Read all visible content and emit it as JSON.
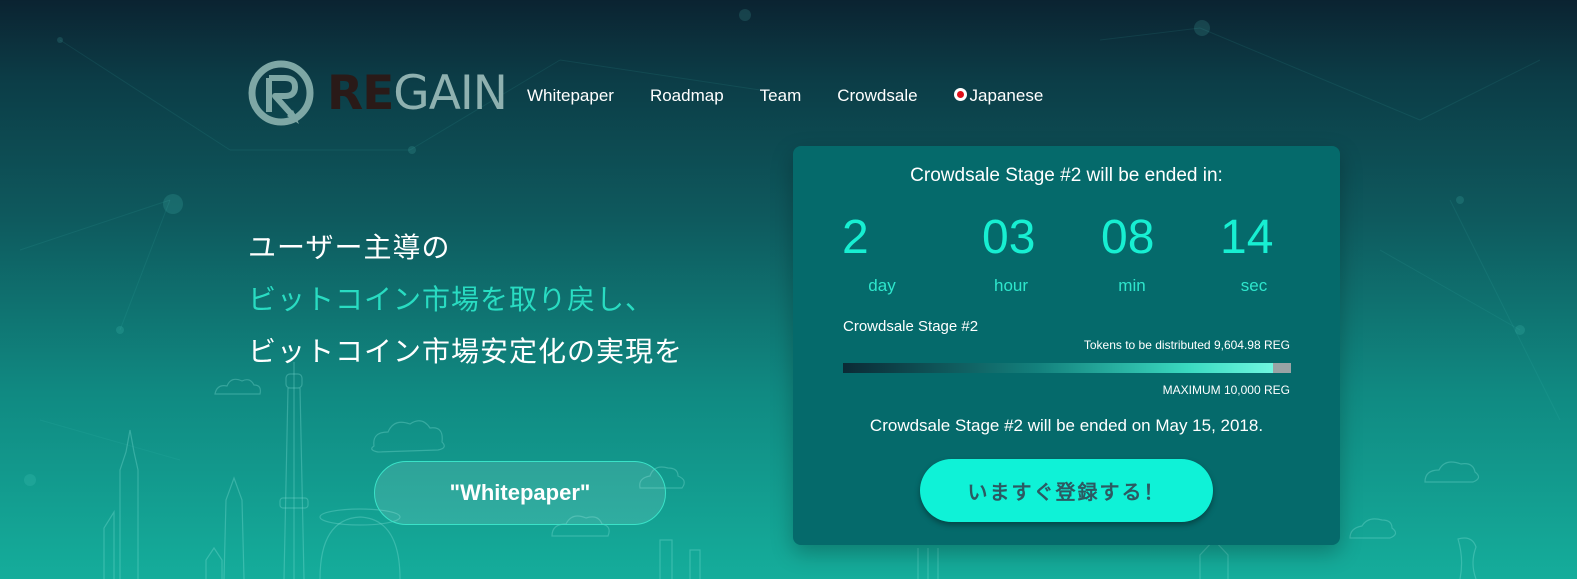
{
  "brand": {
    "logo_re": "RE",
    "logo_gain": "GAIN"
  },
  "nav": {
    "items": [
      {
        "label": "Whitepaper"
      },
      {
        "label": "Roadmap"
      },
      {
        "label": "Team"
      },
      {
        "label": "Crowdsale"
      }
    ],
    "language": {
      "label": "Japanese",
      "flag_icon": "japan-flag-icon"
    }
  },
  "hero": {
    "line1": "ユーザー主導の",
    "line2": "ビットコイン市場を取り戻し、",
    "line3": "ビットコイン市場安定化の実現を",
    "whitepaper_button": "\"Whitepaper\""
  },
  "countdown": {
    "title": "Crowdsale Stage #2 will be ended in:",
    "days": "2",
    "days_unit": "day",
    "hours": "03",
    "hours_unit": "hour",
    "minutes": "08",
    "minutes_unit": "min",
    "seconds": "14",
    "seconds_unit": "sec",
    "stage_label": "Crowdsale Stage #2",
    "tokens_prefix": "Tokens to be distributed",
    "tokens_value": "9,604.98 REG",
    "progress_fraction": 0.9605,
    "maximum_label": "MAXIMUM 10,000 REG",
    "ended_on": "Crowdsale Stage #2 will be ended on May 15, 2018.",
    "register_button": "いますぐ登録する！"
  },
  "colors": {
    "accent": "#17efd2",
    "panel": "#056a6b",
    "button": "#0ff2d7",
    "logo_re": "#2a1a18",
    "logo_gain": "#8fb1b0"
  }
}
